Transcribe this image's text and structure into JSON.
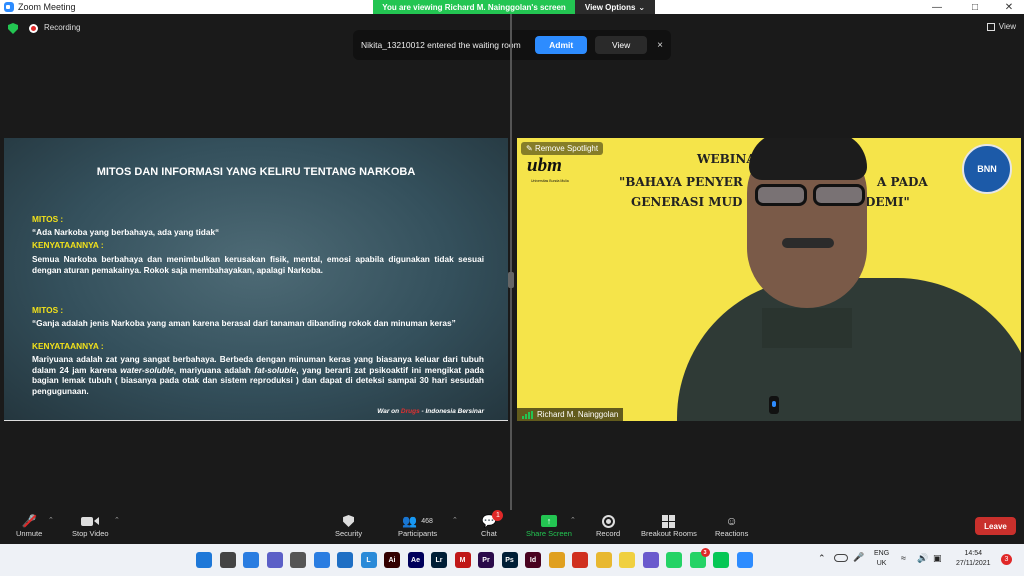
{
  "window": {
    "title": "Zoom Meeting",
    "viewing_banner": "You are viewing Richard M. Nainggolan's screen",
    "view_options": "View Options"
  },
  "top": {
    "recording": "Recording",
    "view": "View"
  },
  "notification": {
    "text": "Nikita_13210012 entered the waiting room",
    "admit": "Admit",
    "view": "View",
    "close": "×"
  },
  "slide": {
    "title": "MITOS DAN INFORMASI YANG KELIRU TENTANG NARKOBA",
    "blocks": [
      {
        "mitos_label": "MITOS :",
        "mitos_text": "“Ada Narkoba yang berbahaya, ada yang tidak“",
        "fact_label": "KENYATAANNYA :",
        "fact_text": "Semua Narkoba berbahaya dan menimbulkan kerusakan fisik, mental, emosi apabila digunakan tidak sesuai dengan aturan pemakainya. Rokok saja membahayakan, apalagi Narkoba."
      },
      {
        "mitos_label": "MITOS :",
        "mitos_text": "“Ganja adalah jenis Narkoba yang aman karena berasal dari tanaman dibanding rokok dan minuman keras”",
        "fact_label": "KENYATAANNYA :",
        "fact_text_1": "Mariyuana adalah zat yang sangat berbahaya. Berbeda dengan minuman keras yang biasanya keluar dari tubuh dalam 24 jam karena ",
        "fact_em_1": "water-soluble",
        "fact_text_2": ", mariyuana adalah ",
        "fact_em_2": "fat-soluble",
        "fact_text_3": ", yang berarti zat psikoaktif ini mengikat pada bagian lemak tubuh ( biasanya pada otak dan sistem reproduksi ) dan dapat di deteksi sampai 30 hari sesudah pengugunaan."
      }
    ],
    "footer_prefix": "War on ",
    "footer_red": "Drugs",
    "footer_suffix": " - Indonesia Bersinar"
  },
  "video": {
    "spotlight": "Remove Spotlight",
    "banner_line1": "WEBINA",
    "banner_line1b": "\"BAHAYA PENYER",
    "banner_line1c": "A PADA",
    "banner_line2": "GENERASI MUD",
    "banner_line2b": "DEMI\"",
    "ubm": "ubm",
    "ubm_sub": "Universitas Bunda Mulia",
    "bnn": "BNN",
    "participant_name": "Richard M. Nainggolan"
  },
  "toolbar": {
    "unmute": "Unmute",
    "stop_video": "Stop Video",
    "security": "Security",
    "participants": "Participants",
    "participants_count": "468",
    "chat": "Chat",
    "chat_badge": "1",
    "share_screen": "Share Screen",
    "record": "Record",
    "breakout_rooms": "Breakout Rooms",
    "reactions": "Reactions",
    "leave": "Leave"
  },
  "taskbar": {
    "apps": [
      {
        "name": "windows-start-icon",
        "label": "",
        "color": "#1e78d8"
      },
      {
        "name": "task-view-icon",
        "label": "",
        "color": "#444"
      },
      {
        "name": "whiteboard-icon",
        "label": "",
        "color": "#2a7de1"
      },
      {
        "name": "teams-icon",
        "label": "",
        "color": "#5b5fc7"
      },
      {
        "name": "calculator-icon",
        "label": "",
        "color": "#555"
      },
      {
        "name": "store-icon",
        "label": "",
        "color": "#2a7de1"
      },
      {
        "name": "mail-icon",
        "label": "",
        "color": "#1f6fc4"
      },
      {
        "name": "launcher-icon",
        "label": "L",
        "color": "#2a8ad8"
      },
      {
        "name": "illustrator-icon",
        "label": "Ai",
        "color": "#330000"
      },
      {
        "name": "after-effects-icon",
        "label": "Ae",
        "color": "#00005b"
      },
      {
        "name": "lightroom-icon",
        "label": "Lr",
        "color": "#001e36"
      },
      {
        "name": "mcafee-icon",
        "label": "M",
        "color": "#c01818"
      },
      {
        "name": "premiere-icon",
        "label": "Pr",
        "color": "#2a0a4a"
      },
      {
        "name": "photoshop-icon",
        "label": "Ps",
        "color": "#001e36"
      },
      {
        "name": "indesign-icon",
        "label": "Id",
        "color": "#49021f"
      },
      {
        "name": "chrome-icon",
        "label": "",
        "color": "#e0a020"
      },
      {
        "name": "chrome-alt-icon",
        "label": "",
        "color": "#d03020"
      },
      {
        "name": "file-explorer-icon",
        "label": "",
        "color": "#e8b830"
      },
      {
        "name": "notes-icon",
        "label": "",
        "color": "#f0d040"
      },
      {
        "name": "messenger-icon",
        "label": "",
        "color": "#6a5acd"
      },
      {
        "name": "whatsapp-icon",
        "label": "",
        "color": "#25d366"
      },
      {
        "name": "whatsapp-beta-icon",
        "label": "",
        "color": "#25d366"
      },
      {
        "name": "line-icon",
        "label": "",
        "color": "#06c755"
      },
      {
        "name": "zoom-app-icon",
        "label": "",
        "color": "#2d8cff"
      }
    ],
    "whatsapp_badge": "3",
    "lang_top": "ENG",
    "lang_bottom": "UK",
    "time": "14:54",
    "date": "27/11/2021",
    "notif_count": "3"
  }
}
